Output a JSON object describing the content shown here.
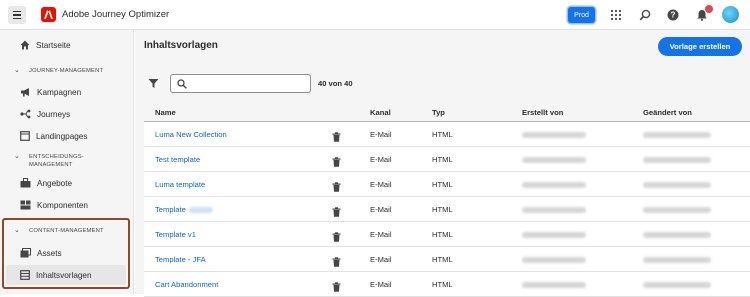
{
  "app": {
    "title": "Adobe Journey Optimizer",
    "prod_badge": "Prod"
  },
  "sidebar": {
    "home": "Startseite",
    "sections": [
      {
        "label": "JOURNEY-MANAGEMENT",
        "items": [
          "Kampagnen",
          "Journeys",
          "Landingpages"
        ]
      },
      {
        "label_line1": "ENTSCHEIDUNGS-",
        "label_line2": "MANAGEMENT",
        "items": [
          "Angebote",
          "Komponenten"
        ]
      },
      {
        "label": "CONTENT-MANAGEMENT",
        "items": [
          "Assets",
          "Inhaltsvorlagen"
        ]
      }
    ]
  },
  "main": {
    "title": "Inhaltsvorlagen",
    "create_button": "Vorlage erstellen",
    "search_placeholder": "",
    "count": "40 von 40",
    "columns": [
      "Name",
      "Kanal",
      "Typ",
      "Erstellt von",
      "Geändert von"
    ],
    "rows": [
      {
        "name": "Luma New Collection",
        "channel": "E-Mail",
        "type": "HTML"
      },
      {
        "name": "Test template",
        "channel": "E-Mail",
        "type": "HTML"
      },
      {
        "name": "Luma template",
        "channel": "E-Mail",
        "type": "HTML"
      },
      {
        "name": "Template",
        "channel": "E-Mail",
        "type": "HTML"
      },
      {
        "name": "Template v1",
        "channel": "E-Mail",
        "type": "HTML"
      },
      {
        "name": "Template - JFA",
        "channel": "E-Mail",
        "type": "HTML"
      },
      {
        "name": "Cart Abandonment",
        "channel": "E-Mail",
        "type": "HTML"
      }
    ]
  },
  "colors": {
    "accent": "#1473e6",
    "link": "#0d66d0",
    "highlight_border": "#8b4a2b",
    "brand": "#eb1000"
  }
}
